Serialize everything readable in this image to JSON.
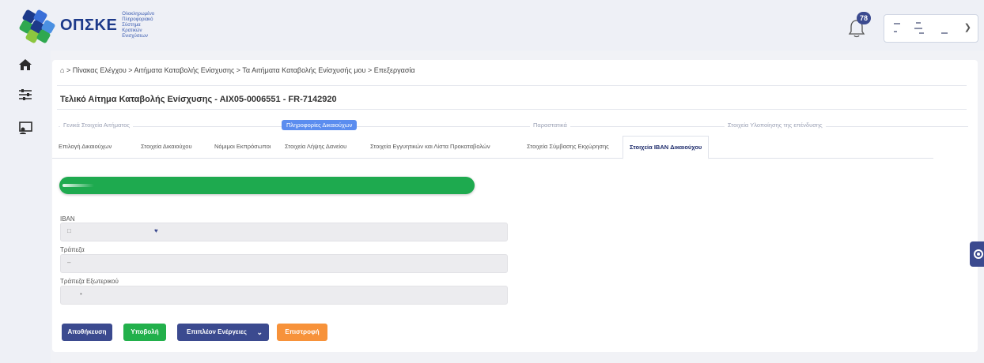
{
  "app": {
    "logo_text": "ΟΠΣΚΕ",
    "logo_subtitle": "Ολοκληρωμένο Πληροφοριακό Σύστημα Κρατικών Ενισχύσεων"
  },
  "header": {
    "notification_count": "78",
    "colors": {
      "badge": "#3b4a8f",
      "topbar": "#eef0f6"
    }
  },
  "sidebar": {
    "items": [
      {
        "icon": "home-icon"
      },
      {
        "icon": "sliders-icon"
      },
      {
        "icon": "screen-user-icon"
      }
    ]
  },
  "breadcrumb": {
    "text": "> Πίνακας Ελέγχου > Αιτήματα Καταβολής Ενίσχυσης > Τα Αιτήματα Καταβολής Ενίσχυσής μου > Επεξεργασία"
  },
  "page": {
    "title": "Τελικό Αίτημα Καταβολής Ενίσχυσης - ΑΙΧ05-0006551 - FR-7142920"
  },
  "steps": [
    {
      "label": "Γενικά Στοιχεία Αιτήματος",
      "active": false
    },
    {
      "label": "Πληροφορίες Δικαιούχων",
      "active": true
    },
    {
      "label": "Παραστατικά",
      "active": false
    },
    {
      "label": "Στοιχεία Υλοποίησης της επένδυσης",
      "active": false
    }
  ],
  "tabs": [
    {
      "label": "Επιλογή Δικαιούχων",
      "active": false
    },
    {
      "label": "Στοιχεία Δικαιούχου",
      "active": false
    },
    {
      "label": "Νόμιμοι Εκπρόσωποι",
      "active": false
    },
    {
      "label": "Στοιχεία Λήψης Δανείου",
      "active": false
    },
    {
      "label": "Στοιχεία Εγγυητικών και Λίστα Προκαταβολών",
      "active": false
    },
    {
      "label": "Στοιχεία Σύμβασης Εκχώρησης",
      "active": false
    },
    {
      "label": "Στοιχεία IBAN Δικαιούχου",
      "active": true
    }
  ],
  "progress": {
    "value": 1.0,
    "color": "#1eaa4f"
  },
  "form": {
    "iban_label": "IBAN",
    "bank_label": "Τράπεζα",
    "foreign_bank_label": "Τράπεζα Εξωτερικού"
  },
  "buttons": {
    "save": {
      "label": "Αποθήκευση",
      "color": "#3b4a8f"
    },
    "submit": {
      "label": "Υποβολή",
      "color": "#22b04b"
    },
    "more": {
      "label": "Επιπλέον Ενέργειες",
      "color": "#3b4a8f"
    },
    "back": {
      "label": "Επιστροφή",
      "color": "#f7923a"
    }
  }
}
